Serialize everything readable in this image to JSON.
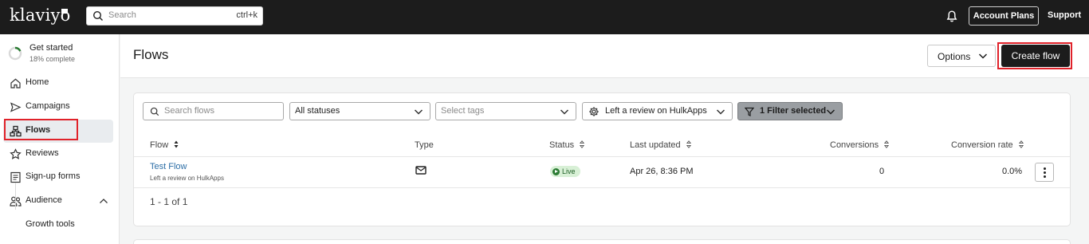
{
  "topbar": {
    "logo": "klaviyo",
    "search_placeholder": "Search",
    "search_shortcut": "ctrl+k",
    "account_plans": "Account Plans",
    "support": "Support"
  },
  "sidebar": {
    "get_started": {
      "title": "Get started",
      "progress_label": "18% complete",
      "progress": 0.18
    },
    "items": [
      {
        "label": "Home",
        "icon": "home-icon"
      },
      {
        "label": "Campaigns",
        "icon": "send-icon"
      },
      {
        "label": "Flows",
        "icon": "flows-icon",
        "active": true
      },
      {
        "label": "Reviews",
        "icon": "star-icon"
      },
      {
        "label": "Sign-up forms",
        "icon": "form-icon"
      },
      {
        "label": "Audience",
        "icon": "audience-icon",
        "expanded": true
      },
      {
        "label": "Growth tools"
      }
    ]
  },
  "header": {
    "title": "Flows",
    "options_label": "Options",
    "create_label": "Create flow"
  },
  "filters": {
    "search_placeholder": "Search flows",
    "status_value": "All statuses",
    "tags_placeholder": "Select tags",
    "trigger_value": "Left a review on HulkApps",
    "filter_count_label": "1 Filter selected"
  },
  "table": {
    "columns": [
      "Flow",
      "Type",
      "Status",
      "Last updated",
      "Conversions",
      "Conversion rate"
    ],
    "rows": [
      {
        "name": "Test Flow",
        "trigger": "Left a review on HulkApps",
        "type_icon": "mail-icon",
        "status": "Live",
        "last_updated": "Apr 26, 8:36 PM",
        "conversions": "0",
        "conversion_rate": "0.0%"
      }
    ],
    "pagination": "1 - 1 of 1"
  },
  "colors": {
    "topbar_bg": "#1c1c1c",
    "highlight_red": "#e0222a",
    "link_blue": "#2c6ea6",
    "live_green": "#2b7b33"
  }
}
